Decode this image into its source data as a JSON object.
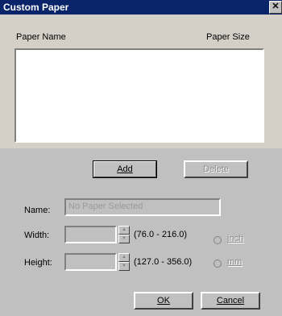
{
  "window": {
    "title": "Custom Paper",
    "close_glyph": "✕"
  },
  "list": {
    "col_name": "Paper Name",
    "col_size": "Paper Size",
    "items": []
  },
  "buttons": {
    "add": "Add",
    "delete": "Delete",
    "ok": "OK",
    "cancel": "Cancel"
  },
  "name": {
    "label": "Name:",
    "value": "No Paper Selected"
  },
  "width": {
    "label": "Width:",
    "value": "",
    "range": "(76.0 - 216.0)"
  },
  "height": {
    "label": "Height:",
    "value": "",
    "range": "(127.0 - 356.0)"
  },
  "units": {
    "inch": "inch",
    "mm": "mm"
  }
}
